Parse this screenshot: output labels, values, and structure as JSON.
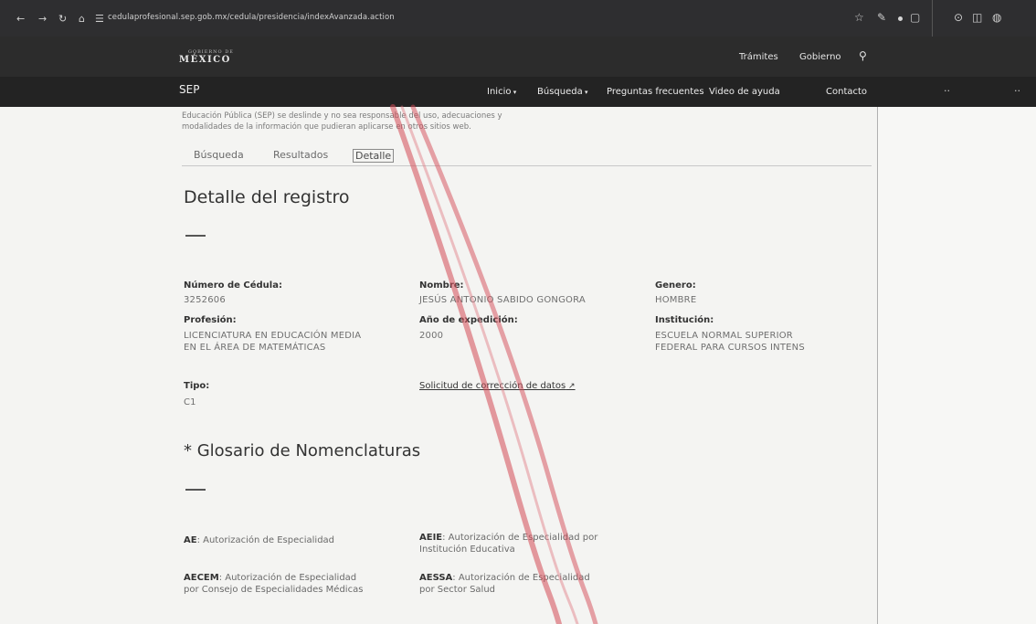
{
  "browser": {
    "url": "cedulaprofesional.sep.gob.mx/cedula/presidencia/indexAvanzada.action"
  },
  "gov_header": {
    "logo_small": "GOBIERNO DE",
    "logo_main": "MÉXICO",
    "links": [
      "Trámites",
      "Gobierno"
    ]
  },
  "sep_nav": {
    "title": "SEP",
    "menu": [
      "Inicio",
      "Búsqueda",
      "Preguntas frecuentes",
      "Video de ayuda",
      "Contacto"
    ]
  },
  "disclaimer": {
    "line1": "Educación Pública (SEP) se deslinde y no sea responsable del uso, adecuaciones y",
    "line2": "modalidades de la información que pudieran aplicarse en otros sitios web."
  },
  "tabs": [
    "Búsqueda",
    "Resultados",
    "Detalle"
  ],
  "detail": {
    "title": "Detalle del registro",
    "cedula_label": "Número de Cédula:",
    "cedula_value": "3252606",
    "nombre_label": "Nombre:",
    "nombre_value": "JESÚS ANTONIO SABIDO GONGORA",
    "genero_label": "Genero:",
    "genero_value": "HOMBRE",
    "profesion_label": "Profesión:",
    "profesion_value_1": "LICENCIATURA EN EDUCACIÓN MEDIA",
    "profesion_value_2": "EN EL ÁREA DE MATEMÁTICAS",
    "anio_label": "Año de expedición:",
    "anio_value": "2000",
    "institucion_label": "Institución:",
    "institucion_value_1": "ESCUELA NORMAL SUPERIOR",
    "institucion_value_2": "FEDERAL PARA CURSOS INTENS",
    "tipo_label": "Tipo:",
    "tipo_value": "C1",
    "correction_link": "Solicitud de corrección de datos"
  },
  "glossary": {
    "title": "* Glosario de Nomenclaturas",
    "items": [
      {
        "code": "AE",
        "text_1": ": Autorización de Especialidad",
        "text_2": ""
      },
      {
        "code": "AEIE",
        "text_1": ": Autorización de Especialidad por",
        "text_2": "Institución Educativa"
      },
      {
        "code": "AECEM",
        "text_1": ": Autorización de Especialidad",
        "text_2": "por Consejo de Especialidades Médicas"
      },
      {
        "code": "AESSA",
        "text_1": ": Autorización de Especialidad",
        "text_2": "por Sector Salud"
      }
    ]
  },
  "colors": {
    "header_dark": "#2c2c2c",
    "nav_dark": "#232323",
    "stamp_red": "#d44a55"
  }
}
